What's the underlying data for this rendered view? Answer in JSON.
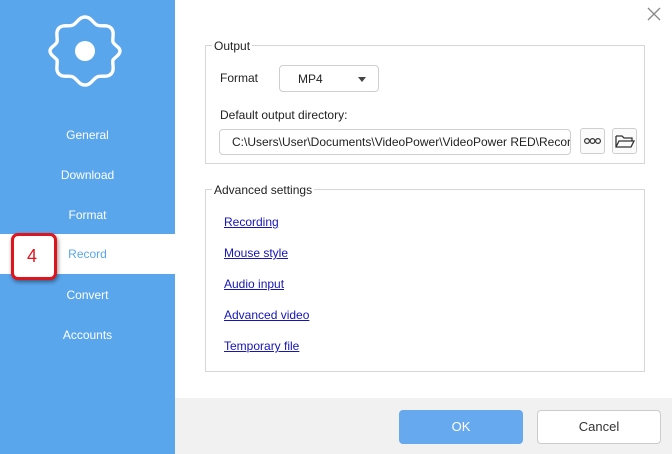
{
  "sidebar": {
    "items": [
      {
        "label": "General"
      },
      {
        "label": "Download"
      },
      {
        "label": "Format"
      },
      {
        "label": "Record",
        "active": true
      },
      {
        "label": "Convert"
      },
      {
        "label": "Accounts"
      }
    ]
  },
  "step_badge": "4",
  "output": {
    "title": "Output",
    "format_label": "Format",
    "format_value": "MP4",
    "dir_label": "Default output directory:",
    "dir_value": "C:\\Users\\User\\Documents\\VideoPower\\VideoPower RED\\Record"
  },
  "advanced": {
    "title": "Advanced settings",
    "links": [
      "Recording",
      "Mouse style",
      "Audio input",
      "Advanced video",
      "Temporary file"
    ]
  },
  "buttons": {
    "ok": "OK",
    "cancel": "Cancel"
  },
  "colors": {
    "sidebar": "#5aa6ed",
    "ok_button": "#66a9ee",
    "link": "#1515b8",
    "badge": "#e0141c"
  }
}
